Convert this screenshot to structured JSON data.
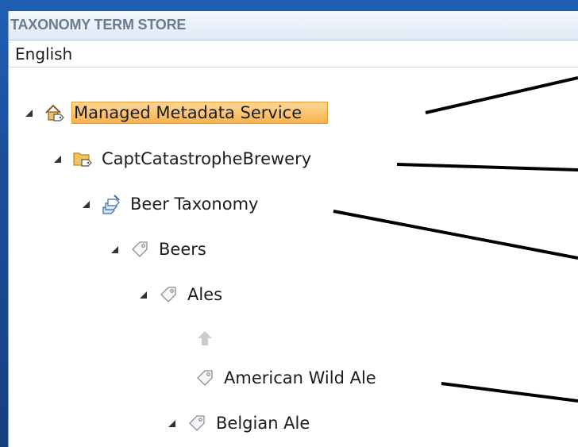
{
  "term_store": {
    "title": "TAXONOMY TERM STORE",
    "language": "English"
  },
  "tree": [
    {
      "label": "Managed Metadata Service",
      "icon": "managed-metadata-service-icon",
      "expanded": true,
      "selected": true
    },
    {
      "label": "CaptCatastropheBrewery",
      "icon": "term-group-folder-icon",
      "expanded": true
    },
    {
      "label": "Beer Taxonomy",
      "icon": "term-set-icon",
      "expanded": true
    },
    {
      "label": "Beers",
      "icon": "term-tag-icon",
      "expanded": true
    },
    {
      "label": "Ales",
      "icon": "term-tag-icon",
      "expanded": true
    },
    {
      "label": "",
      "icon": "move-up-arrow-icon"
    },
    {
      "label": "American Wild Ale",
      "icon": "term-tag-icon",
      "expanded": false
    },
    {
      "label": "Belgian Ale",
      "icon": "term-tag-icon",
      "expanded": true
    }
  ],
  "colors": {
    "background_blue": "#1b4f9c",
    "selection_orange": "#f9b24a",
    "header_text_gray": "#6b7b90"
  }
}
